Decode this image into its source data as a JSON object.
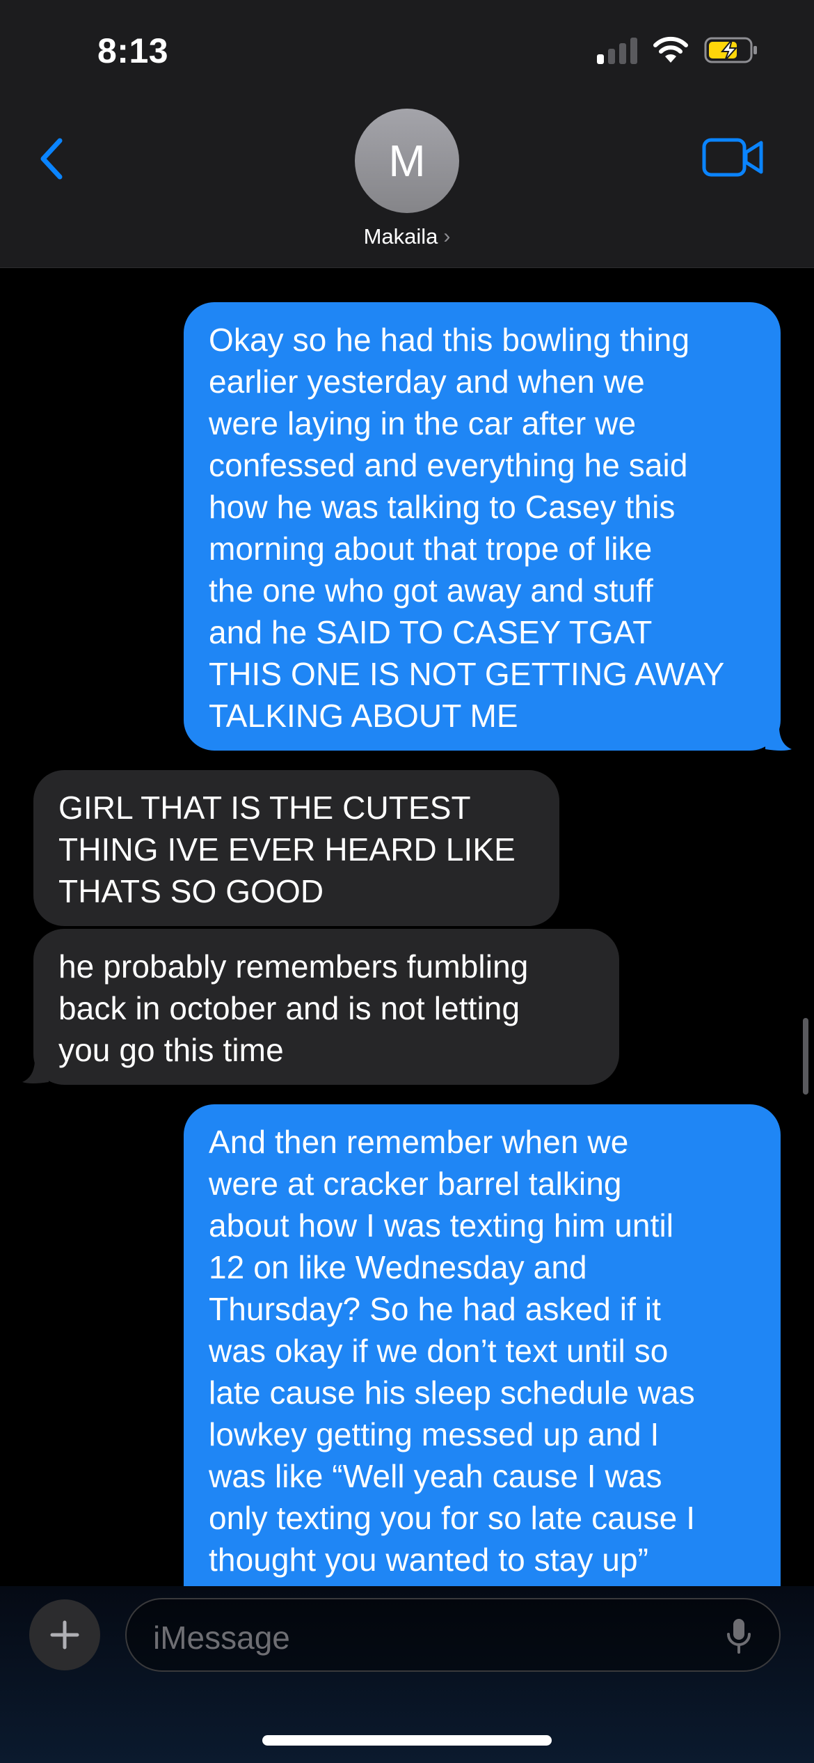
{
  "status_bar": {
    "time": "8:13"
  },
  "header": {
    "avatar_initial": "M",
    "contact_name": "Makaila",
    "chevron": "›"
  },
  "messages": [
    {
      "from": "me",
      "text": "Okay so he had this bowling thing\nearlier yesterday and when we\nwere laying in the car after we\nconfessed and everything he said\nhow he was talking to Casey this\nmorning about that trope of like\nthe one who got away and stuff\nand he SAID TO CASEY TGAT\nTHIS ONE IS NOT GETTING AWAY\nTALKING ABOUT ME"
    },
    {
      "from": "them",
      "text": "GIRL THAT IS THE CUTEST\nTHING IVE EVER HEARD LIKE\nTHATS SO GOOD"
    },
    {
      "from": "them",
      "text": "he probably remembers fumbling\nback in october and is not letting\nyou go this time"
    },
    {
      "from": "me",
      "text": "And then remember when we\nwere at cracker barrel talking\nabout how I was texting him until\n12 on like Wednesday and\nThursday? So he had asked if it\nwas okay if we don’t text until so\nlate cause his sleep schedule was\nlowkey getting messed up and I\nwas like “Well yeah cause I was\nonly texting you for so late cause I\nthought you wanted to stay up”"
    }
  ],
  "input": {
    "placeholder": "iMessage"
  },
  "icons": {
    "back": "chevron-left-icon",
    "video": "video-camera-icon",
    "plus": "plus-icon",
    "mic": "microphone-icon",
    "signal": "cellular-signal-icon",
    "wifi": "wifi-icon",
    "battery": "battery-charging-icon"
  },
  "colors": {
    "accent": "#0a84ff",
    "sent_bubble": "#1f86f5",
    "received_bubble": "#262628",
    "battery_fill": "#ffd60a"
  }
}
